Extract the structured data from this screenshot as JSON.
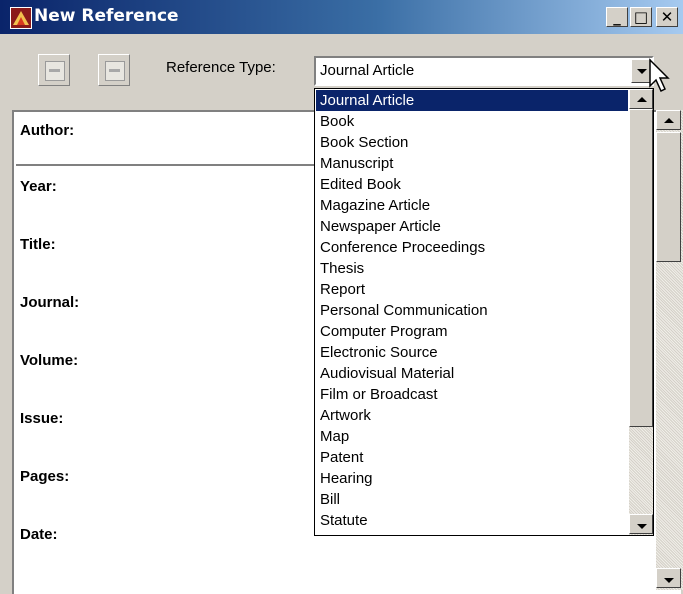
{
  "window": {
    "title": "New Reference",
    "minimize_label": "_",
    "maximize_label": "□",
    "close_label": "✕"
  },
  "toolbar": {
    "reference_type_label": "Reference Type:",
    "reference_type_value": "Journal Article"
  },
  "fields": [
    "Author:",
    "Year:",
    "Title:",
    "Journal:",
    "Volume:",
    "Issue:",
    "Pages:",
    "Date:"
  ],
  "dropdown": {
    "options": [
      "Journal Article",
      "Book",
      "Book Section",
      "Manuscript",
      "Edited Book",
      "Magazine Article",
      "Newspaper Article",
      "Conference Proceedings",
      "Thesis",
      "Report",
      "Personal Communication",
      "Computer Program",
      "Electronic Source",
      "Audiovisual Material",
      "Film or Broadcast",
      "Artwork",
      "Map",
      "Patent",
      "Hearing",
      "Bill",
      "Statute"
    ],
    "selected": "Journal Article"
  }
}
